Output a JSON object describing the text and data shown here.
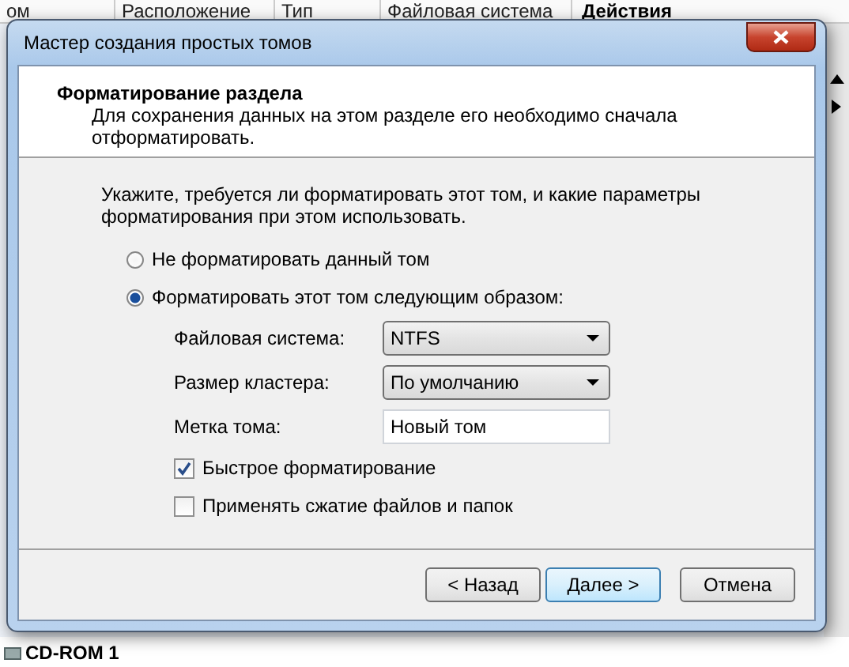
{
  "background": {
    "columns": [
      {
        "label": "ом"
      },
      {
        "label": "Расположение"
      },
      {
        "label": "Тип"
      },
      {
        "label": "Файловая система"
      }
    ],
    "actions_title": "Действия",
    "disk_label": "CD-ROM 1"
  },
  "window": {
    "title": "Мастер создания простых томов"
  },
  "header": {
    "title": "Форматирование раздела",
    "subtitle": "Для сохранения данных на этом разделе его необходимо сначала отформатировать."
  },
  "intro": "Укажите, требуется ли форматировать этот том, и какие параметры форматирования при этом использовать.",
  "options": [
    {
      "label": "Не форматировать данный том",
      "selected": false
    },
    {
      "label": "Форматировать этот том следующим образом:",
      "selected": true
    }
  ],
  "fields": [
    {
      "kind": "dropdown",
      "label": "Файловая система:",
      "value": "NTFS"
    },
    {
      "kind": "dropdown",
      "label": "Размер кластера:",
      "value": "По умолчанию"
    },
    {
      "kind": "text",
      "label": "Метка тома:",
      "value": "Новый том"
    }
  ],
  "checkboxes": [
    {
      "label": "Быстрое форматирование",
      "checked": true
    },
    {
      "label": "Применять сжатие файлов и папок",
      "checked": false
    }
  ],
  "buttons": [
    {
      "label": "< Назад",
      "default": false
    },
    {
      "label": "Далее >",
      "default": true
    },
    {
      "label": "Отмена",
      "default": false
    }
  ]
}
